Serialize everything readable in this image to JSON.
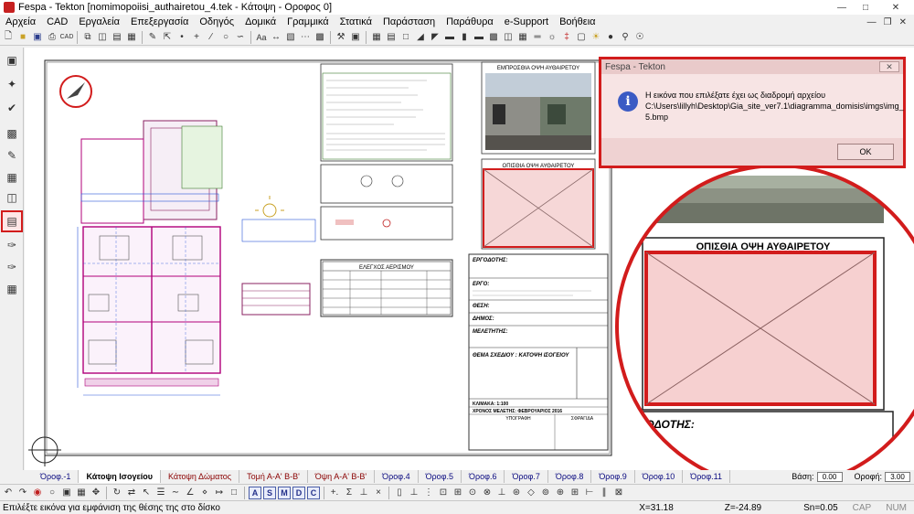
{
  "window": {
    "title": "Fespa - Tekton  [nomimopoiisi_authairetou_4.tek - Κάτοψη - Οροφος 0]"
  },
  "menu": [
    "Αρχεία",
    "CAD",
    "Εργαλεία",
    "Επεξεργασία",
    "Οδηγός",
    "Δομικά",
    "Γραμμικά",
    "Στατικά",
    "Παράσταση",
    "Παράθυρα",
    "e-Support",
    "Βοήθεια"
  ],
  "drawing": {
    "front_view_title": "ΕΜΠΡΟΣΘΙΑ ΟΨΗ ΑΥΘΑΙΡΕΤΟΥ",
    "rear_view_title": "ΟΠΙΣΘΙΑ ΟΨΗ ΑΥΘΑΙΡΕΤΟΥ",
    "checks_title": "ΕΛΕΓΧΟΣ ΑΕΡΙΣΜΟΥ",
    "owner_label": "ΕΡΓΟΔΟΤΗΣ:",
    "project_label": "ΕΡΓΟ:",
    "location_label": "ΘΕΣΗ:",
    "municipality_label": "ΔΗΜΟΣ:",
    "engineer_label": "ΜΕΛΕΤΗΤΗΣ:",
    "subject_label": "ΘΕΜΑ ΣΧΕΔΙΟΥ : ΚΑΤΟΨΗ ΙΣΟΓΕΙΟΥ",
    "scale_label": "ΚΛΙΜΑΚΑ: 1:100",
    "date_label": "ΧΡΟΝΟΣ ΜΕΛΕΤΗΣ: ΦΕΒΡΟΥΑΡΙΟΣ 2016",
    "signature_label": "ΥΠΟΓΡΑΦΗ",
    "stamp_label": "ΣΦΡΑΓΙΔΑ",
    "zoom_rear_title": "ΟΠΙΣΘΙΑ ΟΨΗ ΑΥΘΑΙΡΕΤΟΥ",
    "zoom_owner_label": "ΡΓΟΔΟΤΗΣ:"
  },
  "dialog": {
    "title": "Fespa - Tekton",
    "message_lines": [
      "Η εικόνα που επιλέξατε έχει ως διαδρομή αρχείου",
      "C:\\Users\\lillyh\\Desktop\\Gia_site_ver7.1\\diagramma_domisis\\imgs\\img_",
      "5.bmp"
    ],
    "ok_label": "OK",
    "close_glyph": "✕"
  },
  "tabs": [
    {
      "label": "Όροφ.-1",
      "style": "normal"
    },
    {
      "label": "Κάτοψη Ισογείου",
      "style": "active"
    },
    {
      "label": "Κάτοψη Δώματος",
      "style": "maroon"
    },
    {
      "label": "Τομή Α-Α' Β-Β'",
      "style": "maroon"
    },
    {
      "label": "Όψη Α-Α' Β-Β'",
      "style": "maroon"
    },
    {
      "label": "Όροφ.4",
      "style": "normal"
    },
    {
      "label": "Όροφ.5",
      "style": "normal"
    },
    {
      "label": "Όροφ.6",
      "style": "normal"
    },
    {
      "label": "Όροφ.7",
      "style": "normal"
    },
    {
      "label": "Όροφ.8",
      "style": "normal"
    },
    {
      "label": "Όροφ.9",
      "style": "normal"
    },
    {
      "label": "Όροφ.10",
      "style": "normal"
    },
    {
      "label": "Όροφ.11",
      "style": "normal"
    }
  ],
  "levels": {
    "base_label": "Βάση:",
    "base_value": "0.00",
    "floor_label": "Οροφή:",
    "floor_value": "3.00"
  },
  "bottom_letters": [
    "A",
    "S",
    "M",
    "D",
    "C"
  ],
  "status": {
    "message": "Επιλέξτε εικόνα για εμφάνιση της θέσης της στο δίσκο",
    "x": "X=31.18",
    "z": "Z=-24.89",
    "sn": "Sn=0.05",
    "caps": "CAP",
    "num": "NUM"
  },
  "colors": {
    "alert_red": "#d21c1c",
    "dialog_bg": "#f7e4e4",
    "plan_magenta": "#b0007a",
    "plan_blue": "#2a55d8"
  }
}
